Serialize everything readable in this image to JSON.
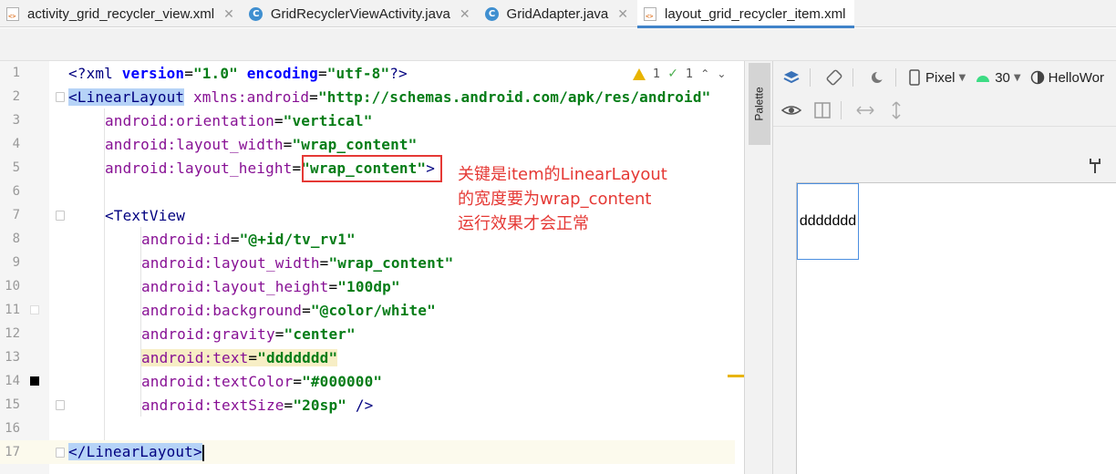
{
  "tabs": [
    {
      "label": "activity_grid_recycler_view.xml",
      "icon": "xml-file-icon",
      "active": false
    },
    {
      "label": "GridRecyclerViewActivity.java",
      "icon": "class-icon",
      "active": false
    },
    {
      "label": "GridAdapter.java",
      "icon": "class-icon",
      "active": false
    },
    {
      "label": "layout_grid_recycler_item.xml",
      "icon": "xml-file-icon",
      "active": true
    }
  ],
  "editor": {
    "line_numbers": [
      "1",
      "2",
      "3",
      "4",
      "5",
      "6",
      "7",
      "8",
      "9",
      "10",
      "11",
      "12",
      "13",
      "14",
      "15",
      "16",
      "17"
    ],
    "inspections": {
      "warnings": "1",
      "ok": "1"
    },
    "lines": {
      "l1": {
        "a": "<?xml ",
        "b": "version",
        "c": "=",
        "d": "\"1.0\"",
        "e": " encoding",
        "f": "=",
        "g": "\"utf-8\"",
        "h": "?>"
      },
      "l2": {
        "tag": "<LinearLayout",
        "attr": " xmlns:android",
        "eq": "=",
        "val": "\"http://schemas.android.com/apk/res/android\""
      },
      "l3": {
        "attr": "android:orientation",
        "eq": "=",
        "val": "\"vertical\""
      },
      "l4": {
        "attr": "android:layout_width",
        "eq": "=",
        "val": "\"wrap_content\""
      },
      "l5": {
        "attr": "android:layout_height",
        "eq": "=",
        "val": "\"wrap_content\"",
        "end": ">"
      },
      "l7": {
        "tag": "<TextView"
      },
      "l8": {
        "attr": "android:id",
        "eq": "=",
        "val": "\"@+id/tv_rv1\""
      },
      "l9": {
        "attr": "android:layout_width",
        "eq": "=",
        "val": "\"wrap_content\""
      },
      "l10": {
        "attr": "android:layout_height",
        "eq": "=",
        "val": "\"100dp\""
      },
      "l11": {
        "attr": "android:background",
        "eq": "=",
        "val": "\"@color/white\""
      },
      "l12": {
        "attr": "android:gravity",
        "eq": "=",
        "val": "\"center\""
      },
      "l13": {
        "attr": "android:text",
        "eq": "=",
        "val": "\"ddddddd\""
      },
      "l14": {
        "attr": "android:textColor",
        "eq": "=",
        "val": "\"#000000\""
      },
      "l15": {
        "attr": "android:textSize",
        "eq": "=",
        "val": "\"20sp\"",
        "end": " />"
      },
      "l17": {
        "tag": "</LinearLayout>"
      }
    },
    "annotation": [
      "关键是item的LinearLayout",
      "的宽度要为wrap_content",
      "运行效果才会正常"
    ]
  },
  "palette": {
    "label": "Palette"
  },
  "design": {
    "device": "Pixel",
    "api": "30",
    "theme": "HelloWor",
    "preview_text": "ddddddd"
  },
  "colors": {
    "attribute": "#871094",
    "string": "#067d17",
    "tag": "#000080",
    "annotation": "#e53935",
    "selection": "#4a8ee0"
  }
}
